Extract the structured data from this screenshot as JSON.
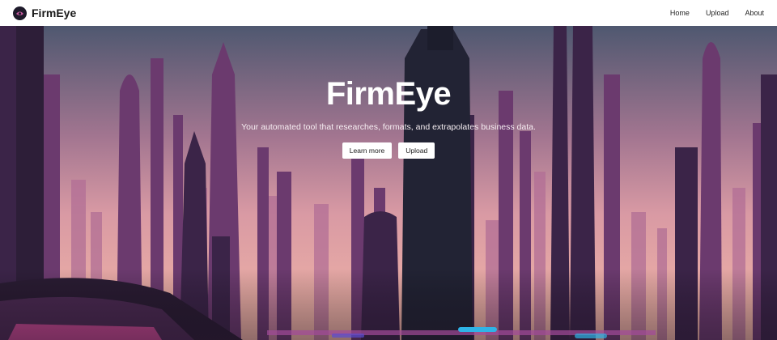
{
  "navbar": {
    "brand": "FirmEye",
    "links": [
      {
        "label": "Home"
      },
      {
        "label": "Upload"
      },
      {
        "label": "About"
      }
    ]
  },
  "hero": {
    "title": "FirmEye",
    "subtitle": "Your automated tool that researches, formats, and extrapolates business data.",
    "buttons": [
      {
        "label": "Learn more"
      },
      {
        "label": "Upload"
      }
    ]
  },
  "colors": {
    "sky_top": "#4f5870",
    "sky_mid": "#c98a9a",
    "sky_bottom": "#f2b6a6",
    "tower_dark": "#2a2540",
    "tower_mid": "#4a2b55",
    "tower_light": "#8b4f86",
    "accent_cyan": "#2fb3e6"
  }
}
